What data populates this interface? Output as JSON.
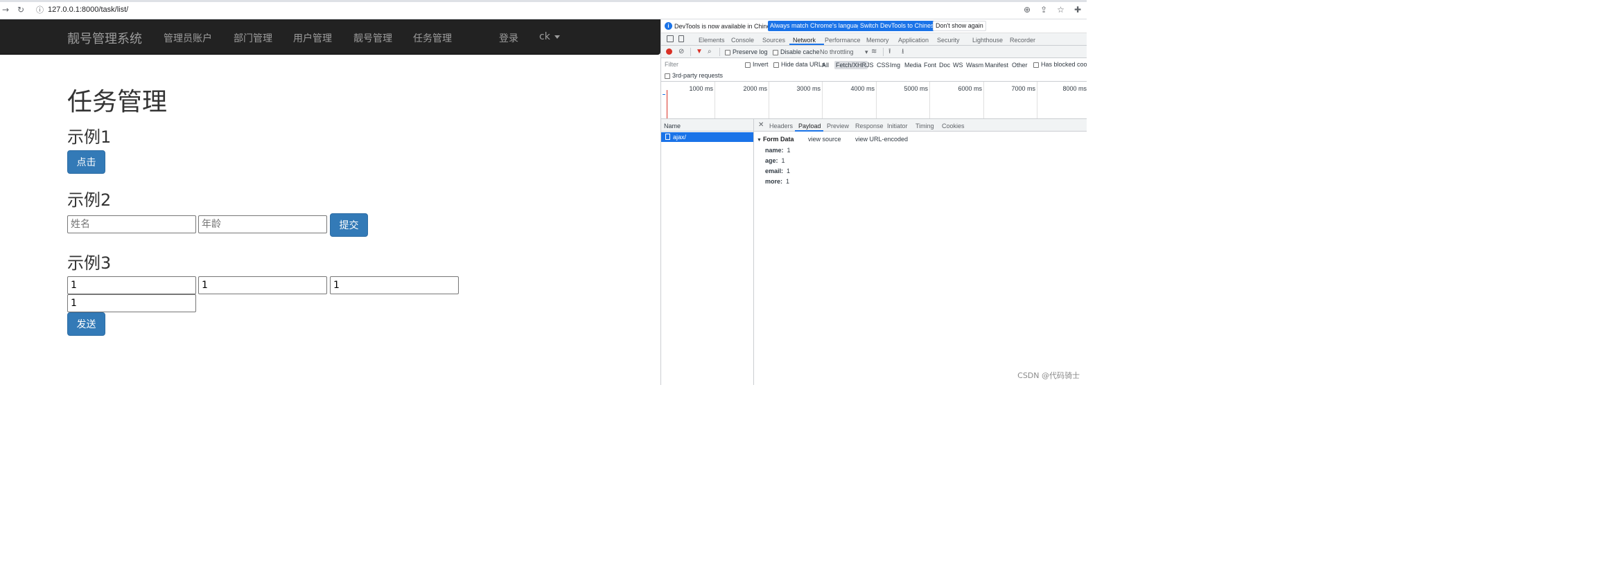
{
  "browser": {
    "url": "127.0.0.1:8000/task/list/",
    "back_icon": "arrow-right-icon",
    "reload_icon": "reload-icon"
  },
  "navbar": {
    "brand": "靓号管理系统",
    "items": [
      "管理员账户",
      "部门管理",
      "用户管理",
      "靓号管理",
      "任务管理"
    ],
    "login": "登录",
    "user": "ck"
  },
  "main": {
    "title": "任务管理",
    "example1": {
      "heading": "示例1",
      "button": "点击"
    },
    "example2": {
      "heading": "示例2",
      "name_placeholder": "姓名",
      "age_placeholder": "年龄",
      "button": "提交"
    },
    "example3": {
      "heading": "示例3",
      "values": [
        "1",
        "1",
        "1",
        "1"
      ],
      "button": "发送"
    }
  },
  "devtools": {
    "info_text": "DevTools is now available in Chinese!",
    "btn_match": "Always match Chrome's language",
    "btn_switch": "Switch DevTools to Chinese",
    "btn_dismiss": "Don't show again",
    "tabs": [
      "Elements",
      "Console",
      "Sources",
      "Network",
      "Performance",
      "Memory",
      "Application",
      "Security",
      "Lighthouse",
      "Recorder"
    ],
    "active_tab": "Network",
    "toolbar": {
      "preserve_log": "Preserve log",
      "disable_cache": "Disable cache",
      "throttling": "No throttling"
    },
    "filter": {
      "placeholder": "Filter",
      "invert": "Invert",
      "hide_data_urls": "Hide data URLs",
      "types": [
        "All",
        "Fetch/XHR",
        "JS",
        "CSS",
        "Img",
        "Media",
        "Font",
        "Doc",
        "WS",
        "Wasm",
        "Manifest",
        "Other"
      ],
      "active_type": "Fetch/XHR",
      "blocked_cookies": "Has blocked cookies",
      "third_party": "3rd-party requests"
    },
    "timeline": [
      "1000 ms",
      "2000 ms",
      "3000 ms",
      "4000 ms",
      "5000 ms",
      "6000 ms",
      "7000 ms",
      "8000 ms"
    ],
    "name_header": "Name",
    "request": "ajax/",
    "detail_tabs": [
      "Headers",
      "Payload",
      "Preview",
      "Response",
      "Initiator",
      "Timing",
      "Cookies"
    ],
    "active_detail_tab": "Payload",
    "form_data": {
      "title": "Form Data",
      "view_source": "view source",
      "view_url_encoded": "view URL-encoded",
      "fields": [
        {
          "key": "name:",
          "value": "1"
        },
        {
          "key": "age:",
          "value": "1"
        },
        {
          "key": "email:",
          "value": "1"
        },
        {
          "key": "more:",
          "value": "1"
        }
      ]
    }
  },
  "watermark": "CSDN @代码骑士",
  "colors": {
    "navbar_bg": "#222222",
    "primary": "#337ab7",
    "devtools_blue": "#1a73e8",
    "record_red": "#d93025"
  }
}
